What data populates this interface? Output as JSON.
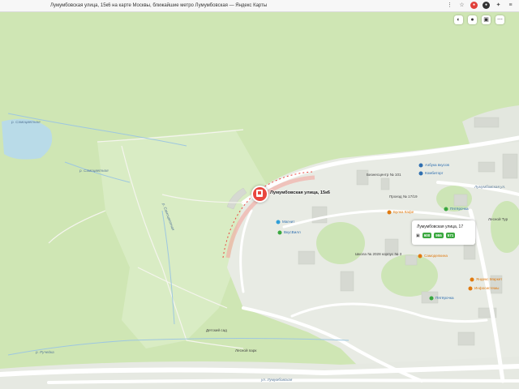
{
  "browser": {
    "tab_title": "Лумумбовская улица, 15к6 на карте Москвы, ближайшие метро Лумумбовская — Яндекс Карты"
  },
  "colors": {
    "forest": "#cfe6b4",
    "urban": "#e8ebe4",
    "road": "#ffffff",
    "water": "#b9dbe8",
    "pin": "#e9473f",
    "route_badge": "#3aa83f"
  },
  "map_controls": [
    "layers-icon",
    "traffic-icon",
    "transport-icon",
    "more-icon"
  ],
  "selected_place": {
    "label": "Лумумбовская улица, 15к6"
  },
  "stop_popup": {
    "title": "Лумумбовская улица, 17",
    "routes": [
      "600",
      "955",
      "571"
    ]
  },
  "labels": {
    "river_top": "р. Самоцветная",
    "river_mid": "р. Самоцветная",
    "river_bottom": "р. Ручейка",
    "stream_left": "р. Самоцветная",
    "poi_magnit": "Магнит",
    "poi_vkusvill": "ВкусВилл",
    "poi_azbuka": "Азбука вкусов",
    "poi_kombitorg": "Комбиторг",
    "poi_pyaterochka": "Пятёрочка",
    "poi_pyaterochka2": "Пятёрочка",
    "poi_bakery": "Булка Кафе",
    "poi_shop": "Самоделкина",
    "poi_yandex": "Яндекс Маркет",
    "poi_pharmacy": "Инфосистемы",
    "school_1": "Детский сад",
    "school_2": "Школа № 2028 корпус № 3",
    "park_forest": "Лесной парк",
    "street_right": "Лумумбовская ул.",
    "street_bottom": "ул. Лумумбовская",
    "building_1": "Бизнесцентр № 101",
    "building_2": "Проезд № 17/19",
    "bottom_poi": "Лесной Тур"
  }
}
